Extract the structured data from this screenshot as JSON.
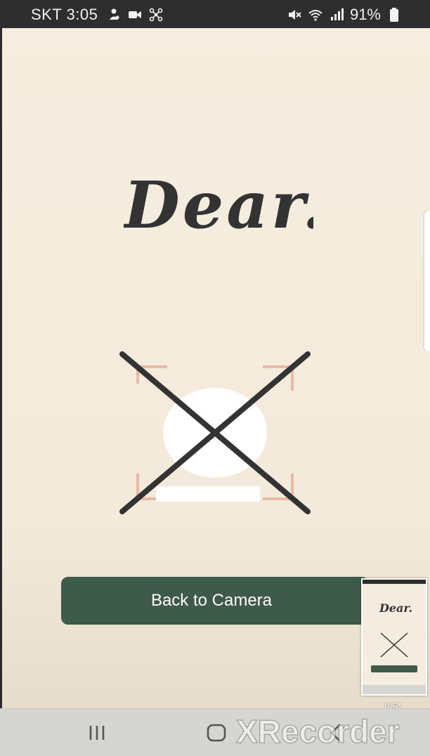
{
  "status_bar": {
    "carrier": "SKT",
    "time": "3:05",
    "battery": "91%",
    "left_icons": [
      "person-icon",
      "video-camera-icon",
      "network-icon"
    ],
    "right_icons": [
      "mute-icon",
      "wifi-icon",
      "signal-icon",
      "battery-icon"
    ]
  },
  "logo": {
    "text": "Dear."
  },
  "illustration": {
    "icon": "face-frame-crossed-icon"
  },
  "button": {
    "label": "Back to Camera",
    "color": "#3d5a4a"
  },
  "recorder": {
    "elapsed": "0:51",
    "watermark": "XRecorder"
  },
  "nav_bar": {
    "icons": [
      "recents-icon",
      "home-icon",
      "back-icon"
    ]
  },
  "colors": {
    "background": "#f4ecdf",
    "ink": "#333333",
    "frame_corner": "#e8b9a6"
  }
}
